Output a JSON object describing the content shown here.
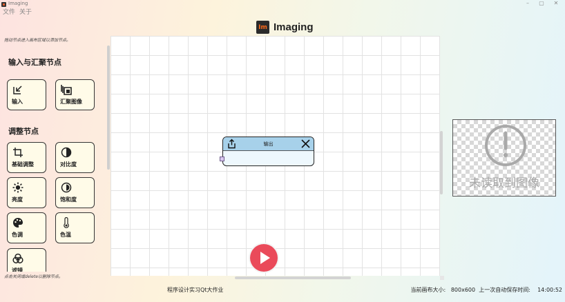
{
  "window": {
    "title": "Imaging",
    "minimize": "–",
    "maximize": "▢",
    "close": "✕"
  },
  "menu": [
    "文件",
    "关于"
  ],
  "brand": {
    "logo": "Im",
    "title": "Imaging"
  },
  "palette": {
    "hint_top": "拖动节点进入画布区域以添加节点。",
    "hint_bottom": "点击关闭或delete以删除节点。",
    "sections": [
      {
        "title": "输入与汇聚节点",
        "items": [
          {
            "label": "输入",
            "icon": "input-icon"
          },
          {
            "label": "汇聚图像",
            "icon": "merge-icon"
          }
        ]
      },
      {
        "title": "调整节点",
        "items": [
          {
            "label": "基础调整",
            "icon": "crop-icon"
          },
          {
            "label": "对比度",
            "icon": "contrast-icon"
          },
          {
            "label": "亮度",
            "icon": "brightness-icon"
          },
          {
            "label": "饱和度",
            "icon": "saturation-icon"
          },
          {
            "label": "色调",
            "icon": "palette-icon"
          },
          {
            "label": "色温",
            "icon": "thermometer-icon"
          },
          {
            "label": "滤镜",
            "icon": "filter-icon"
          }
        ]
      }
    ]
  },
  "canvas": {
    "node": {
      "title": "输出",
      "export_icon": "export-icon",
      "close_icon": "close-icon"
    }
  },
  "run_button": {
    "icon": "play-icon"
  },
  "preview": {
    "message": "未读取到图像",
    "icon": "alert-circle-icon"
  },
  "status": {
    "left": "程序设计实习Qt大作业",
    "right": "当前画布大小:   800x600  上一次自动保存时间:    14:00:52"
  },
  "colors": {
    "accent": "#ea4a5a",
    "node_header": "#a7d1ea",
    "button_bg": "#fffbe8"
  }
}
